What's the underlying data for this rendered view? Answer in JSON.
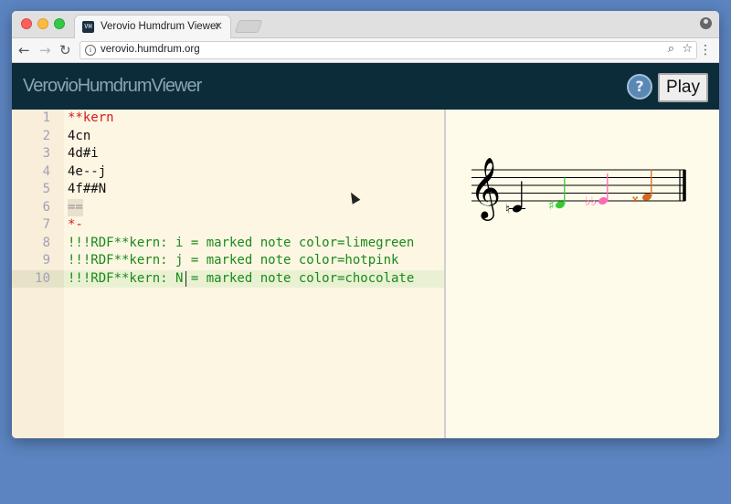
{
  "browser": {
    "tab_title": "Verovio Humdrum Viewer",
    "tab_close": "×",
    "favicon_text": "VH",
    "url": "verovio.humdrum.org",
    "back_glyph": "←",
    "forward_glyph": "→",
    "reload_glyph": "↻",
    "zoom_glyph": "⌕",
    "star_glyph": "☆",
    "menu_glyph": "⋮",
    "info_glyph": "i"
  },
  "app": {
    "title": "VerovioHumdrumViewer",
    "help_label": "?",
    "play_label": "Play",
    "header_color": "#0d2c3a"
  },
  "editor": {
    "lines": [
      {
        "num": "1",
        "text": "**kern",
        "color": "red"
      },
      {
        "num": "2",
        "text": "4cn",
        "color": "black"
      },
      {
        "num": "3",
        "text": "4d#i",
        "color": "black"
      },
      {
        "num": "4",
        "text": "4e--j",
        "color": "black"
      },
      {
        "num": "5",
        "text": "4f##N",
        "color": "black"
      },
      {
        "num": "6",
        "text": "==",
        "color": "gray"
      },
      {
        "num": "7",
        "text": "*-",
        "color": "red"
      },
      {
        "num": "8",
        "text": "!!!RDF**kern: i = marked note color=limegreen",
        "color": "green"
      },
      {
        "num": "9",
        "text": "!!!RDF**kern: j = marked note color=hotpink",
        "color": "green"
      },
      {
        "num": "10",
        "text": "!!!RDF**kern: N = marked note color=chocolate",
        "color": "green"
      }
    ],
    "active_line": "10"
  },
  "notation": {
    "clef_glyph": "𝄞",
    "notes": [
      {
        "pitch": "c",
        "accidental": "natural",
        "color": "#000000"
      },
      {
        "pitch": "d",
        "accidental": "sharp",
        "color": "#32cd32"
      },
      {
        "pitch": "e",
        "accidental": "double-flat",
        "color": "#ff69b4"
      },
      {
        "pitch": "f",
        "accidental": "double-sharp",
        "color": "#d2691e"
      }
    ],
    "natural_glyph": "♮",
    "sharp_glyph": "♯",
    "double_flat_glyph": "♭♭",
    "double_sharp_glyph": "𝄪"
  }
}
